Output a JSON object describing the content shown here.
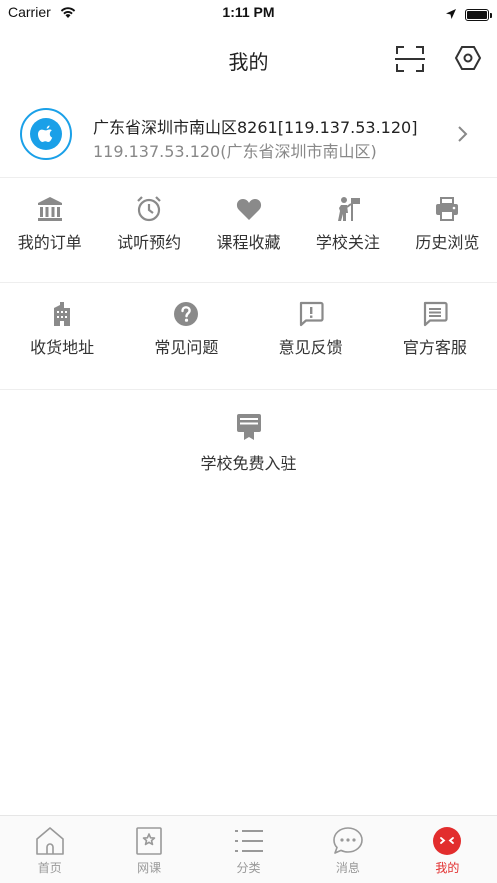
{
  "status_bar": {
    "carrier": "Carrier",
    "time": "1:11 PM",
    "battery_level": 1.0
  },
  "header": {
    "title": "我的",
    "scan_icon": "scan-icon",
    "settings_icon": "settings-hexagon-icon"
  },
  "profile": {
    "avatar_icon": "apple-logo-icon",
    "name": "广东省深圳市南山区8261[119.137.53.120]",
    "subtitle": "119.137.53.120(广东省深圳市南山区)"
  },
  "grid_row1": [
    {
      "label": "我的订单",
      "icon": "bank-icon"
    },
    {
      "label": "试听预约",
      "icon": "alarm-clock-icon"
    },
    {
      "label": "课程收藏",
      "icon": "heart-icon"
    },
    {
      "label": "学校关注",
      "icon": "person-flag-icon"
    },
    {
      "label": "历史浏览",
      "icon": "printer-icon"
    }
  ],
  "grid_row2": [
    {
      "label": "收货地址",
      "icon": "building-icon"
    },
    {
      "label": "常见问题",
      "icon": "help-circle-icon"
    },
    {
      "label": "意见反馈",
      "icon": "feedback-icon"
    },
    {
      "label": "官方客服",
      "icon": "message-icon"
    }
  ],
  "school_join": {
    "label": "学校免费入驻",
    "icon": "certificate-icon"
  },
  "tabbar": [
    {
      "label": "首页",
      "icon": "home-icon",
      "active": false
    },
    {
      "label": "网课",
      "icon": "bookmark-star-icon",
      "active": false
    },
    {
      "label": "分类",
      "icon": "list-icon",
      "active": false
    },
    {
      "label": "消息",
      "icon": "chat-icon",
      "active": false
    },
    {
      "label": "我的",
      "icon": "profile-face-icon",
      "active": true
    }
  ],
  "colors": {
    "accent": "#e22d2d",
    "avatar_ring": "#1aa0e8",
    "icon_gray": "#8a8a8a",
    "tab_gray": "#999999"
  }
}
